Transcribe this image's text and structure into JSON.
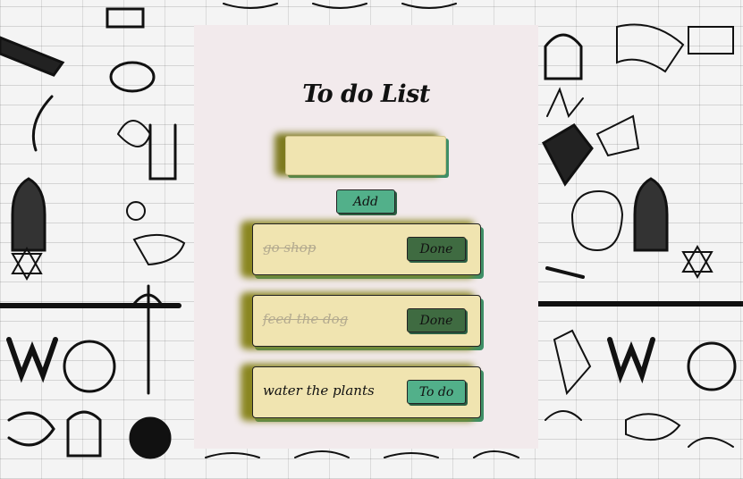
{
  "header": {
    "title": "To do List"
  },
  "form": {
    "input_value": "",
    "add_label": "Add"
  },
  "todos": [
    {
      "text": "go shop",
      "completed": true,
      "button_label": "Done"
    },
    {
      "text": "feed the dog",
      "completed": true,
      "button_label": "Done"
    },
    {
      "text": "water the plants",
      "completed": false,
      "button_label": "To do"
    }
  ],
  "colors": {
    "panel_bg": "#f2eaec",
    "card_bg": "#f0e4b0",
    "done_button": "#3f6b41",
    "todo_button": "#52b08a",
    "accent_shadow": "#3f8f67",
    "glow": "#8a8620"
  }
}
